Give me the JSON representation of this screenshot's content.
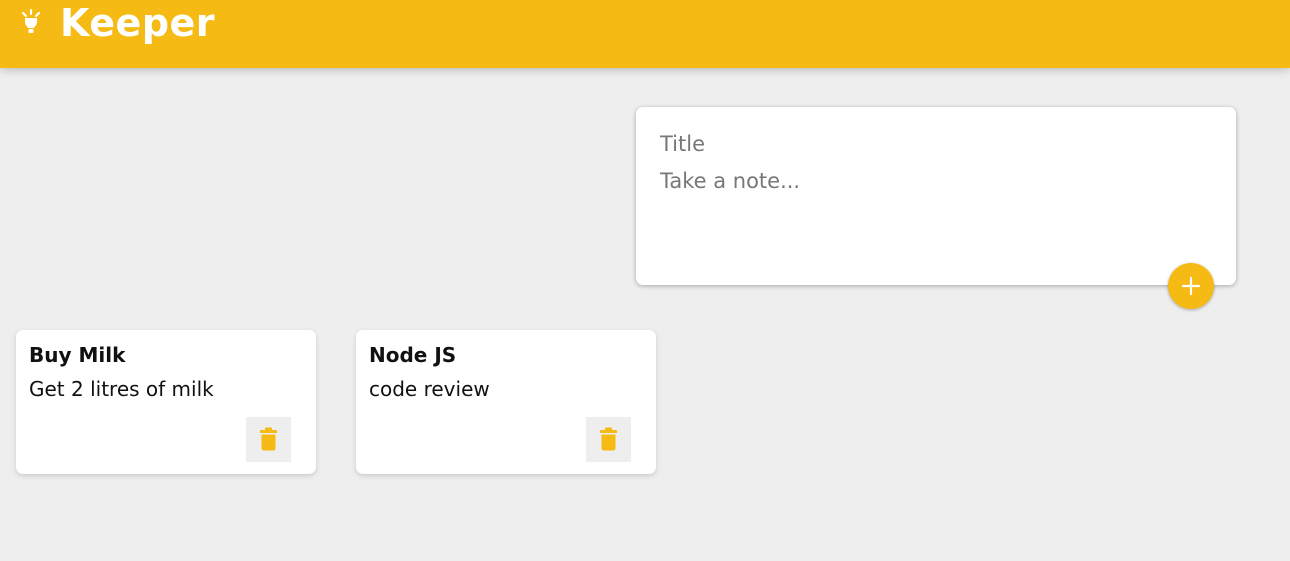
{
  "header": {
    "app_title": "Keeper",
    "logo_icon": "lightbulb-icon",
    "background_color": "#f5ba13"
  },
  "create_area": {
    "title_placeholder": "Title",
    "content_placeholder": "Take a note...",
    "add_icon": "plus-icon"
  },
  "notes": [
    {
      "title": "Buy Milk",
      "content": "Get 2 litres of milk",
      "delete_icon": "trash-icon"
    },
    {
      "title": "Node JS",
      "content": "code review",
      "delete_icon": "trash-icon"
    }
  ],
  "colors": {
    "accent": "#f5ba13",
    "background": "#eeeeee",
    "card": "#ffffff"
  }
}
